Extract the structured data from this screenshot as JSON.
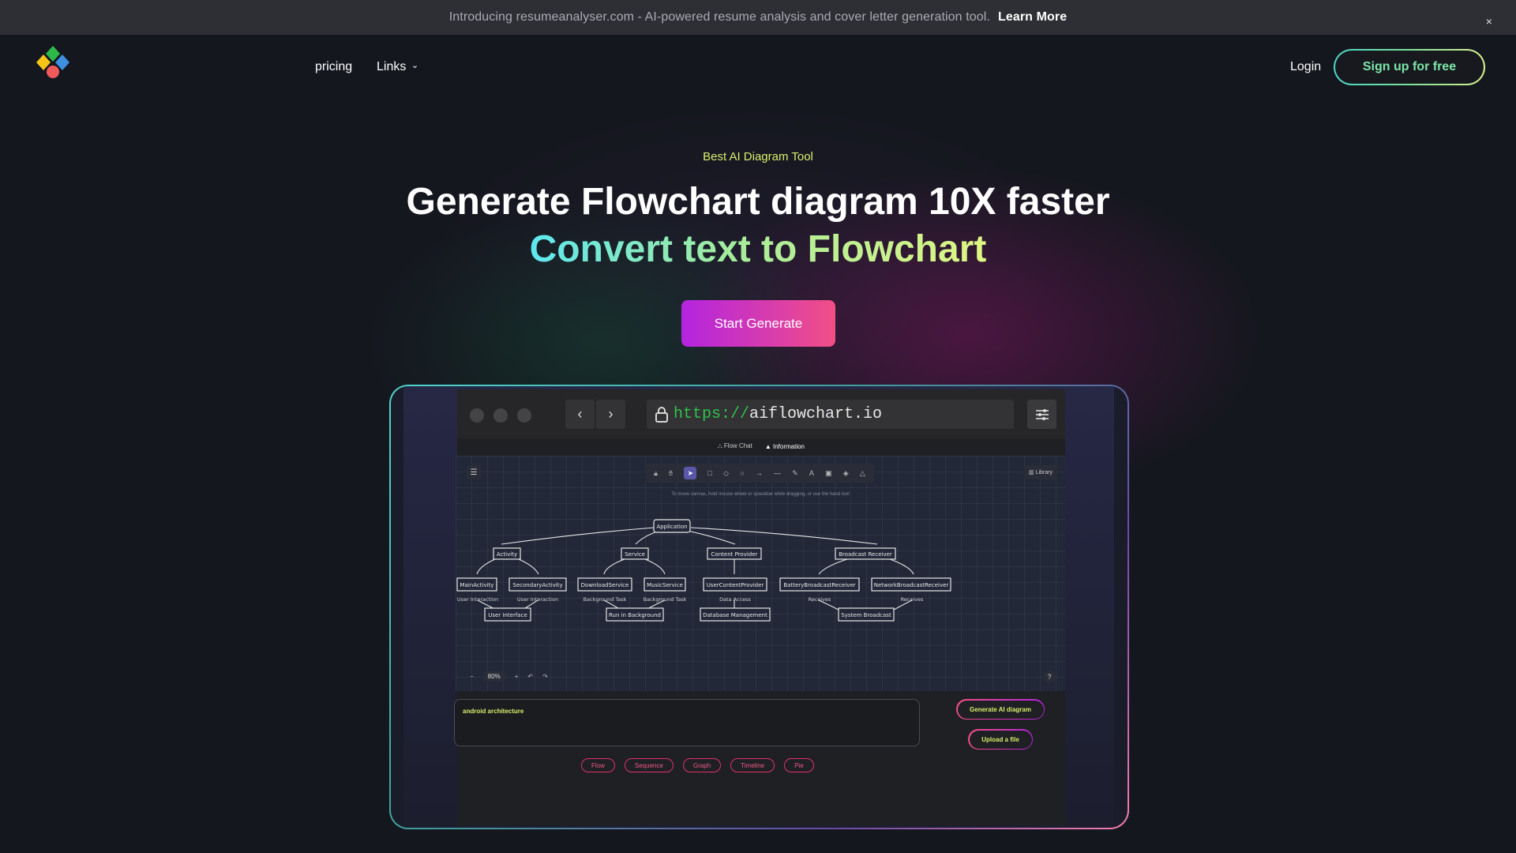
{
  "announcement": {
    "text": "Introducing resumeanalyser.com - AI-powered resume analysis and cover letter generation tool.",
    "link": "Learn More",
    "close": "×"
  },
  "nav": {
    "logo_icon": "diamond-logo-icon",
    "links": [
      "pricing",
      "Links"
    ],
    "links_chevron": "⌄",
    "login": "Login",
    "signup": "Sign up for free"
  },
  "hero": {
    "eyebrow": "Best AI Diagram Tool",
    "title": "Generate Flowchart diagram 10X faster",
    "subtitle": "Convert text to Flowchart",
    "cta": "Start Generate"
  },
  "colors": {
    "accent_green": "#d7ee6b",
    "cta_start": "#b424e0",
    "cta_end": "#f24f86",
    "background": "#15171f"
  },
  "demo": {
    "browser": {
      "url_scheme": "https://",
      "url_host": "aiflowchart.io",
      "back_icon": "‹",
      "forward_icon": "›",
      "lock_icon": "lock-icon",
      "settings_icon": "sliders-icon"
    },
    "app": {
      "tabs": [
        "Flow Chat",
        "Information"
      ],
      "library": "Library",
      "hint": "To move canvas, hold mouse wheel or spacebar while dragging, or use the hand tool",
      "zoom": "80%",
      "diagram": {
        "root": "Application",
        "level1": [
          "Activity",
          "Service",
          "Content Provider",
          "Broadcast Receiver"
        ],
        "level2": [
          "MainActivity",
          "SecondaryActivity",
          "DownloadService",
          "MusicService",
          "UserContentProvider",
          "BatteryBroadcastReceiver",
          "NetworkBroadcastReceiver"
        ],
        "edge_labels": [
          "User Interaction",
          "User Interaction",
          "Background Task",
          "Background Task",
          "Data Access",
          "Receives",
          "Receives"
        ],
        "level3": [
          "User Interface",
          "Run in Background",
          "Database Management",
          "System Broadcast"
        ]
      },
      "prompt": "android architecture",
      "generate": "Generate AI diagram",
      "upload": "Upload a file",
      "chips": [
        "Flow",
        "Sequence",
        "Graph",
        "Timeline",
        "Pie"
      ]
    }
  }
}
